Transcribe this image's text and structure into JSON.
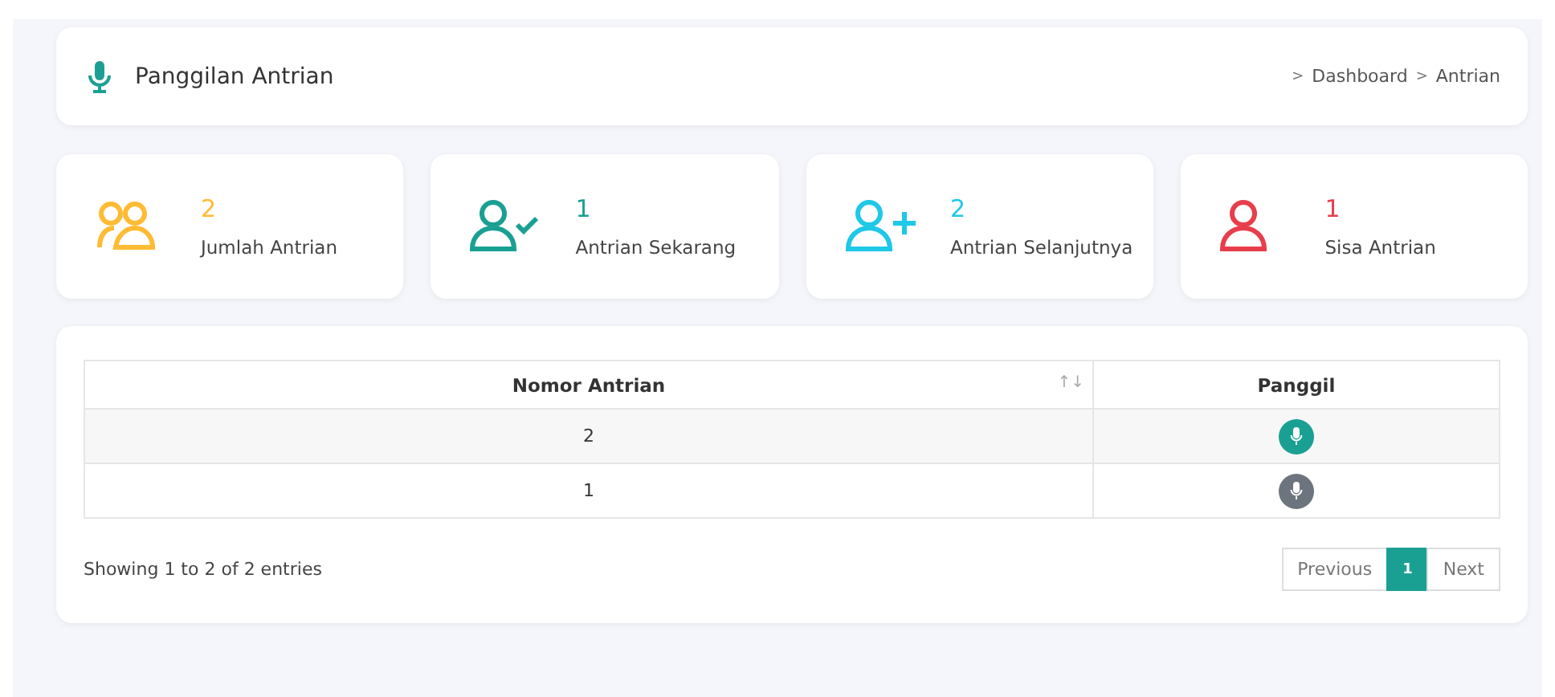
{
  "header": {
    "title": "Panggilan Antrian",
    "breadcrumb": [
      {
        "separator": ">",
        "label": "Dashboard"
      },
      {
        "separator": ">",
        "label": "Antrian"
      }
    ]
  },
  "stats": [
    {
      "kind": "group",
      "value": "2",
      "label": "Jumlah Antrian",
      "color": "#ffbb33"
    },
    {
      "kind": "check",
      "value": "1",
      "label": "Antrian Sekarang",
      "color": "#1aa093"
    },
    {
      "kind": "add",
      "value": "2",
      "label": "Antrian Selanjutnya",
      "color": "#1ec8e7"
    },
    {
      "kind": "single",
      "value": "1",
      "label": "Sisa Antrian",
      "color": "#e83e4c"
    }
  ],
  "table": {
    "columns": [
      {
        "label": "Nomor Antrian",
        "sort_icon": "↑↓"
      },
      {
        "label": "Panggil"
      }
    ],
    "rows": [
      {
        "nomor": "2",
        "active": true
      },
      {
        "nomor": "1",
        "active": false
      }
    ]
  },
  "info": "Showing 1 to 2 of 2 entries",
  "pagination": [
    {
      "label": "Previous",
      "selected": false
    },
    {
      "label": "1",
      "selected": true
    },
    {
      "label": "Next",
      "selected": false
    }
  ]
}
